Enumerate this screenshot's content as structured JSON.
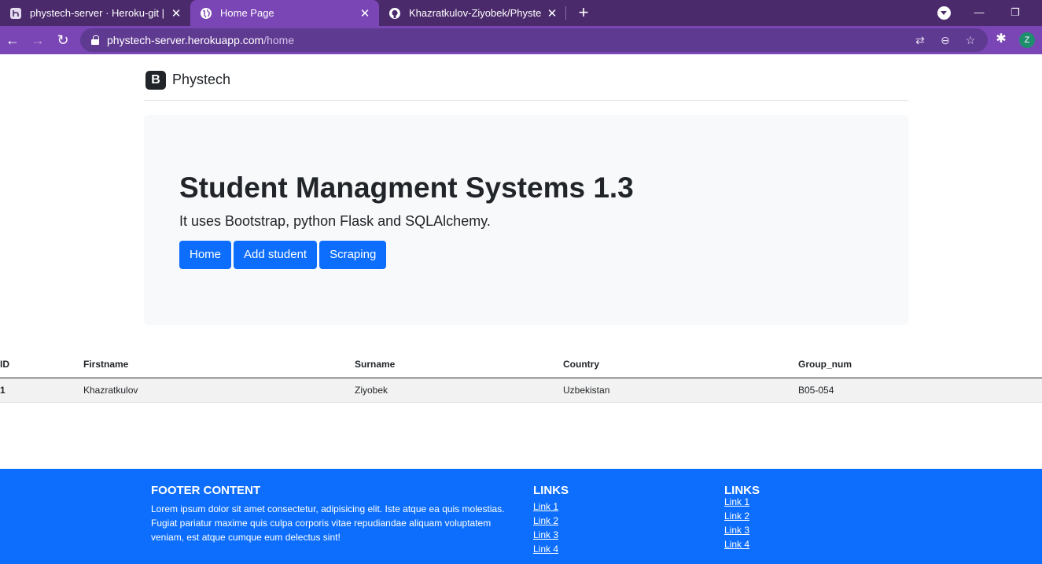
{
  "browser": {
    "tabs": [
      {
        "title": "phystech-server · Heroku-git | Heroku",
        "favicon": "heroku-icon",
        "active": false
      },
      {
        "title": "Home Page",
        "favicon": "globe-icon",
        "active": true
      },
      {
        "title": "Khazratkulov-Ziyobek/Phystech-server",
        "favicon": "github-icon",
        "active": false
      }
    ],
    "url_host": "phystech-server.herokuapp.com",
    "url_path": "/home",
    "profile_initial": "Z",
    "colors": {
      "tabbar": "#4b2a6b",
      "toolbar": "#7a45b5",
      "omnibox": "#5f3a91"
    }
  },
  "navbar": {
    "brand_logo": "B",
    "brand_name": "Phystech"
  },
  "hero": {
    "title": "Student Managment Systems 1.3",
    "lead": "It uses Bootstrap, python Flask and SQLAlchemy.",
    "buttons": [
      {
        "label": "Home"
      },
      {
        "label": "Add student"
      },
      {
        "label": "Scraping"
      }
    ]
  },
  "table": {
    "columns": [
      "ID",
      "Firstname",
      "Surname",
      "Country",
      "Group_num"
    ],
    "rows": [
      [
        "1",
        "Khazratkulov",
        "Ziyobek",
        "Uzbekistan",
        "B05-054"
      ]
    ]
  },
  "footer": {
    "heading": "FOOTER CONTENT",
    "text": "Lorem ipsum dolor sit amet consectetur, adipisicing elit. Iste atque ea quis molestias. Fugiat pariatur maxime quis culpa corporis vitae repudiandae aliquam voluptatem veniam, est atque cumque eum delectus sint!",
    "links_1": {
      "heading": "LINKS",
      "items": [
        "Link 1",
        "Link 2",
        "Link 3",
        "Link 4"
      ]
    },
    "links_2": {
      "heading": "LINKS",
      "items": [
        "Link 1",
        "Link 2",
        "Link 3",
        "Link 4"
      ]
    },
    "color": "#0d6efd"
  }
}
